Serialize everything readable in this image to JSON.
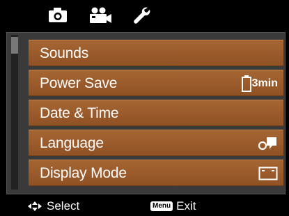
{
  "tabs": [
    {
      "icon": "camera-icon",
      "selected": false
    },
    {
      "icon": "movie-camera-icon",
      "selected": false
    },
    {
      "icon": "wrench-icon",
      "selected": true
    }
  ],
  "menu": {
    "items": [
      {
        "label": "Sounds",
        "indicator": null
      },
      {
        "label": "Power Save",
        "indicator": {
          "icon": "battery-icon",
          "text": "3min"
        }
      },
      {
        "label": "Date & Time",
        "indicator": null
      },
      {
        "label": "Language",
        "indicator": {
          "icon": "speech-bubble-icon"
        }
      },
      {
        "label": "Display Mode",
        "indicator": {
          "icon": "display-mode-icon"
        }
      }
    ]
  },
  "footer": {
    "select_text": "Select",
    "menu_key": "Menu",
    "exit_text": "Exit",
    "nav_icon": "navigation-arrows-icon"
  },
  "colors": {
    "item_bg": "#9a5a2b",
    "panel_bg": "#3a3a3a",
    "background": "#000000"
  }
}
